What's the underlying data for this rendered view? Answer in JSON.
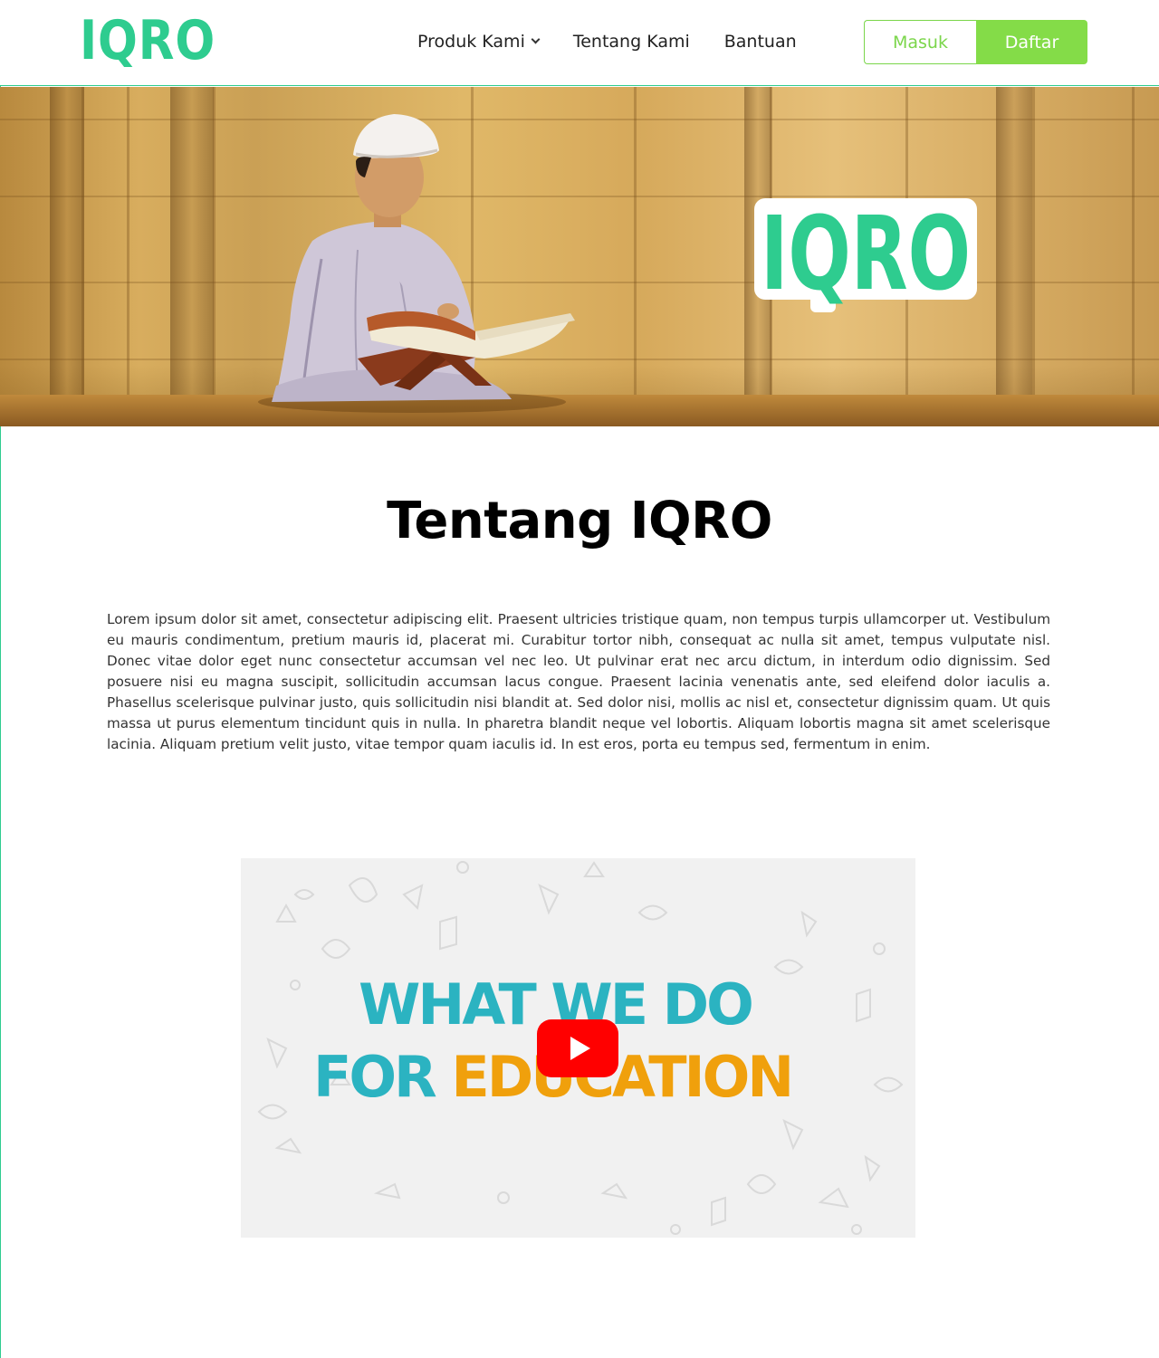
{
  "header": {
    "logo_text": "IQRO",
    "nav": [
      {
        "label": "Produk Kami",
        "has_dropdown": true
      },
      {
        "label": "Tentang Kami",
        "has_dropdown": false
      },
      {
        "label": "Bantuan",
        "has_dropdown": false
      }
    ],
    "login_label": "Masuk",
    "register_label": "Daftar"
  },
  "hero": {
    "logo_text": "IQRO"
  },
  "about": {
    "title": "Tentang IQRO",
    "body": "Lorem ipsum dolor sit amet, consectetur adipiscing elit. Praesent ultricies tristique quam, non tempus turpis ullamcorper ut. Vestibulum eu mauris condimentum, pretium mauris id, placerat mi. Curabitur tortor nibh, consequat ac nulla sit amet, tempus vulputate nisl. Donec vitae dolor eget nunc consectetur accumsan vel nec leo. Ut pulvinar erat nec arcu dictum, in interdum odio dignissim. Sed posuere nisi eu magna suscipit, sollicitudin accumsan lacus congue. Praesent lacinia venenatis ante, sed eleifend dolor iaculis a. Phasellus scelerisque pulvinar justo, quis sollicitudin nisi blandit at. Sed dolor nisi, mollis ac nisl et, consectetur dignissim quam. Ut quis massa ut purus elementum tincidunt quis in nulla. In pharetra blandit neque vel lobortis. Aliquam lobortis magna sit amet scelerisque lacinia. Aliquam pretium velit justo, vitae tempor quam iaculis id. In est eros, porta eu tempus sed, fermentum in enim."
  },
  "video": {
    "line1": "WHAT WE DO",
    "line2_a": "FOR ",
    "line2_b": "EDUCATION",
    "play_icon": "youtube-play-icon"
  },
  "colors": {
    "brand_green": "#2ecc8f",
    "button_green": "#84dc48",
    "video_teal": "#2bb3c1",
    "video_orange": "#f0a00c",
    "youtube_red": "#ff0000"
  }
}
